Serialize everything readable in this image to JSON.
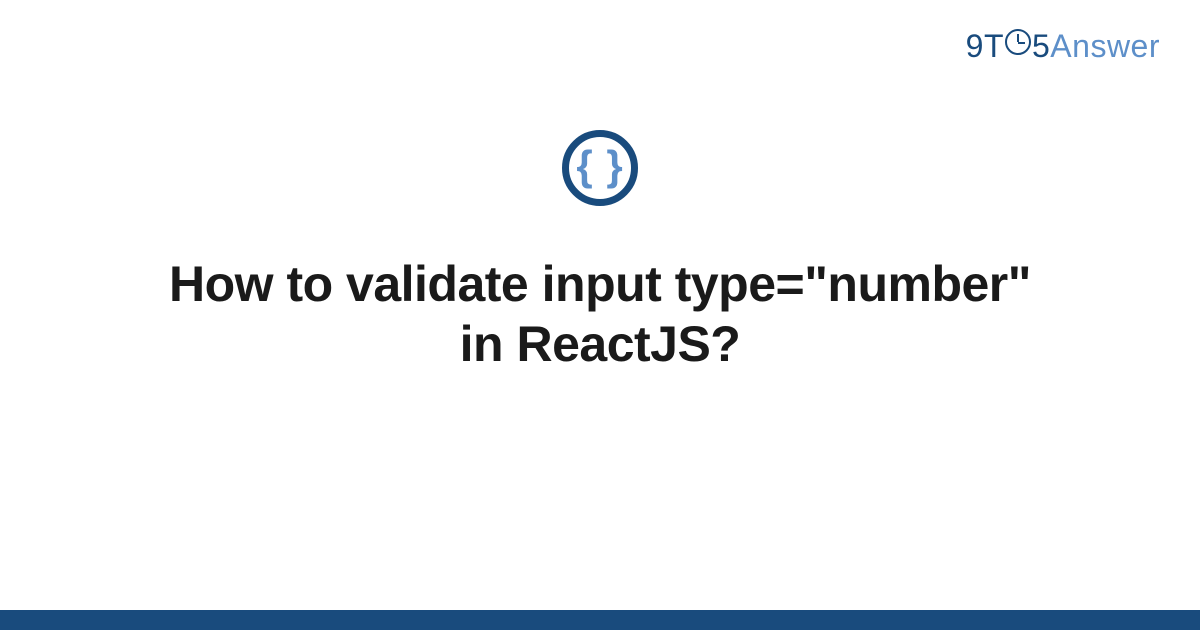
{
  "logo": {
    "left": "9T",
    "mid": "5",
    "right": "Answer"
  },
  "icon": {
    "braces": "{ }"
  },
  "title": "How to validate input type=\"number\" in ReactJS?",
  "colors": {
    "brand_dark": "#194b7d",
    "brand_light": "#5d8fc9"
  }
}
